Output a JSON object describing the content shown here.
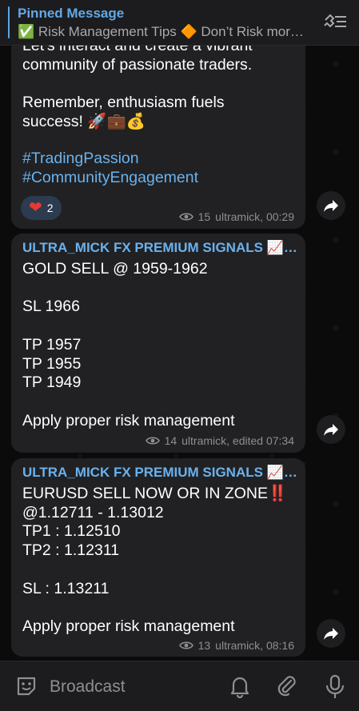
{
  "pinned": {
    "title": "Pinned Message",
    "subtitle": "✅ Risk Management Tips   🔶 Don’t Risk mor…"
  },
  "messages": [
    {
      "text_top": "Let's interact and create a vibrant\ncommunity of passionate traders.\n\n Remember, enthusiasm fuels\nsuccess! 🚀💼💰",
      "hashtag1": "#TradingPassion",
      "hashtag2": "#CommunityEngagement",
      "reaction_count": "2",
      "views": "15",
      "author_time": "ultramick, 00:29"
    },
    {
      "sender": "ULTRA_MICK FX PREMIUM SIGNALS 📈📉…",
      "text": "GOLD SELL @ 1959-1962\n\nSL 1966\n\nTP 1957\nTP 1955\nTP 1949\n\nApply proper risk management",
      "views": "14",
      "author_time": "ultramick, edited 07:34"
    },
    {
      "sender": "ULTRA_MICK FX PREMIUM SIGNALS 📈📉…",
      "text": "EURUSD SELL NOW OR IN ZONE‼️\n@1.12711 - 1.13012\nTP1 : 1.12510\nTP2 : 1.12311\n\nSL : 1.13211\n\nApply proper risk management",
      "views": "13",
      "author_time": "ultramick, 08:16"
    }
  ],
  "composer": {
    "placeholder": "Broadcast"
  },
  "colors": {
    "accent": "#6ab2ee",
    "bubble": "#212123",
    "reaction": "#e53935"
  }
}
